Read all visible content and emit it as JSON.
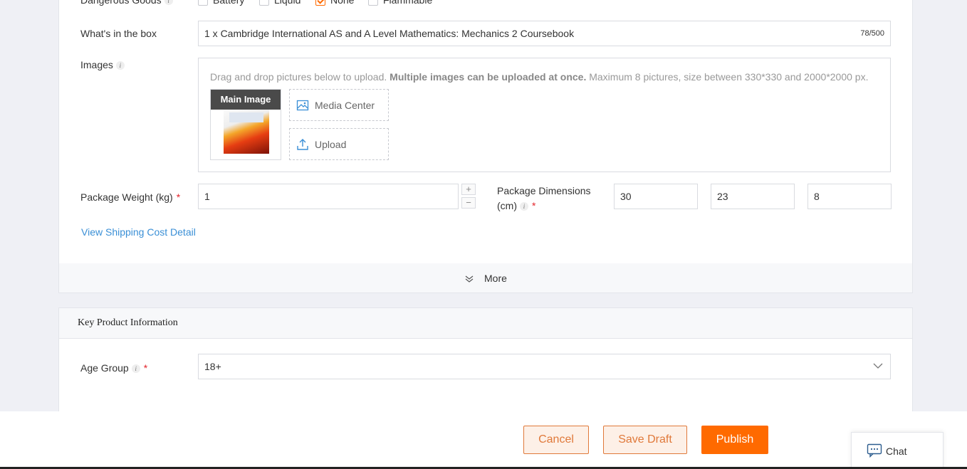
{
  "product": {
    "dangerous_goods": {
      "label": "Dangerous Goods",
      "options": [
        {
          "label": "Battery",
          "checked": false
        },
        {
          "label": "Liquid",
          "checked": false
        },
        {
          "label": "None",
          "checked": true
        },
        {
          "label": "Flammable",
          "checked": false
        }
      ]
    },
    "whats_in_box": {
      "label": "What's in the box",
      "value": "1 x Cambridge International AS and A Level Mathematics: Mechanics 2 Coursebook",
      "counter": "78/500"
    },
    "images": {
      "label": "Images",
      "hint_pre": "Drag and drop pictures below to upload. ",
      "hint_bold": "Multiple images can be uploaded at once.",
      "hint_post": " Maximum 8 pictures, size between 330*330 and 2000*2000 px.",
      "main_image_label": "Main Image",
      "media_center": "Media Center",
      "upload": "Upload"
    },
    "package_weight": {
      "label": "Package Weight (kg)",
      "value": "1",
      "plus": "+",
      "minus": "−"
    },
    "package_dimensions": {
      "label_line1": "Package Dimensions",
      "label_line2": "(cm)",
      "length": "30",
      "width": "23",
      "height": "8"
    },
    "shipping_link": "View Shipping Cost Detail",
    "more_label": "More"
  },
  "key_info": {
    "title": "Key Product Information",
    "age_group": {
      "label": "Age Group",
      "value": "18+"
    }
  },
  "footer": {
    "cancel": "Cancel",
    "save_draft": "Save Draft",
    "publish": "Publish"
  },
  "chat": {
    "label": "Chat"
  },
  "colors": {
    "accent": "#ff6a00",
    "link": "#3a8fd6",
    "required": "#e3242b"
  }
}
